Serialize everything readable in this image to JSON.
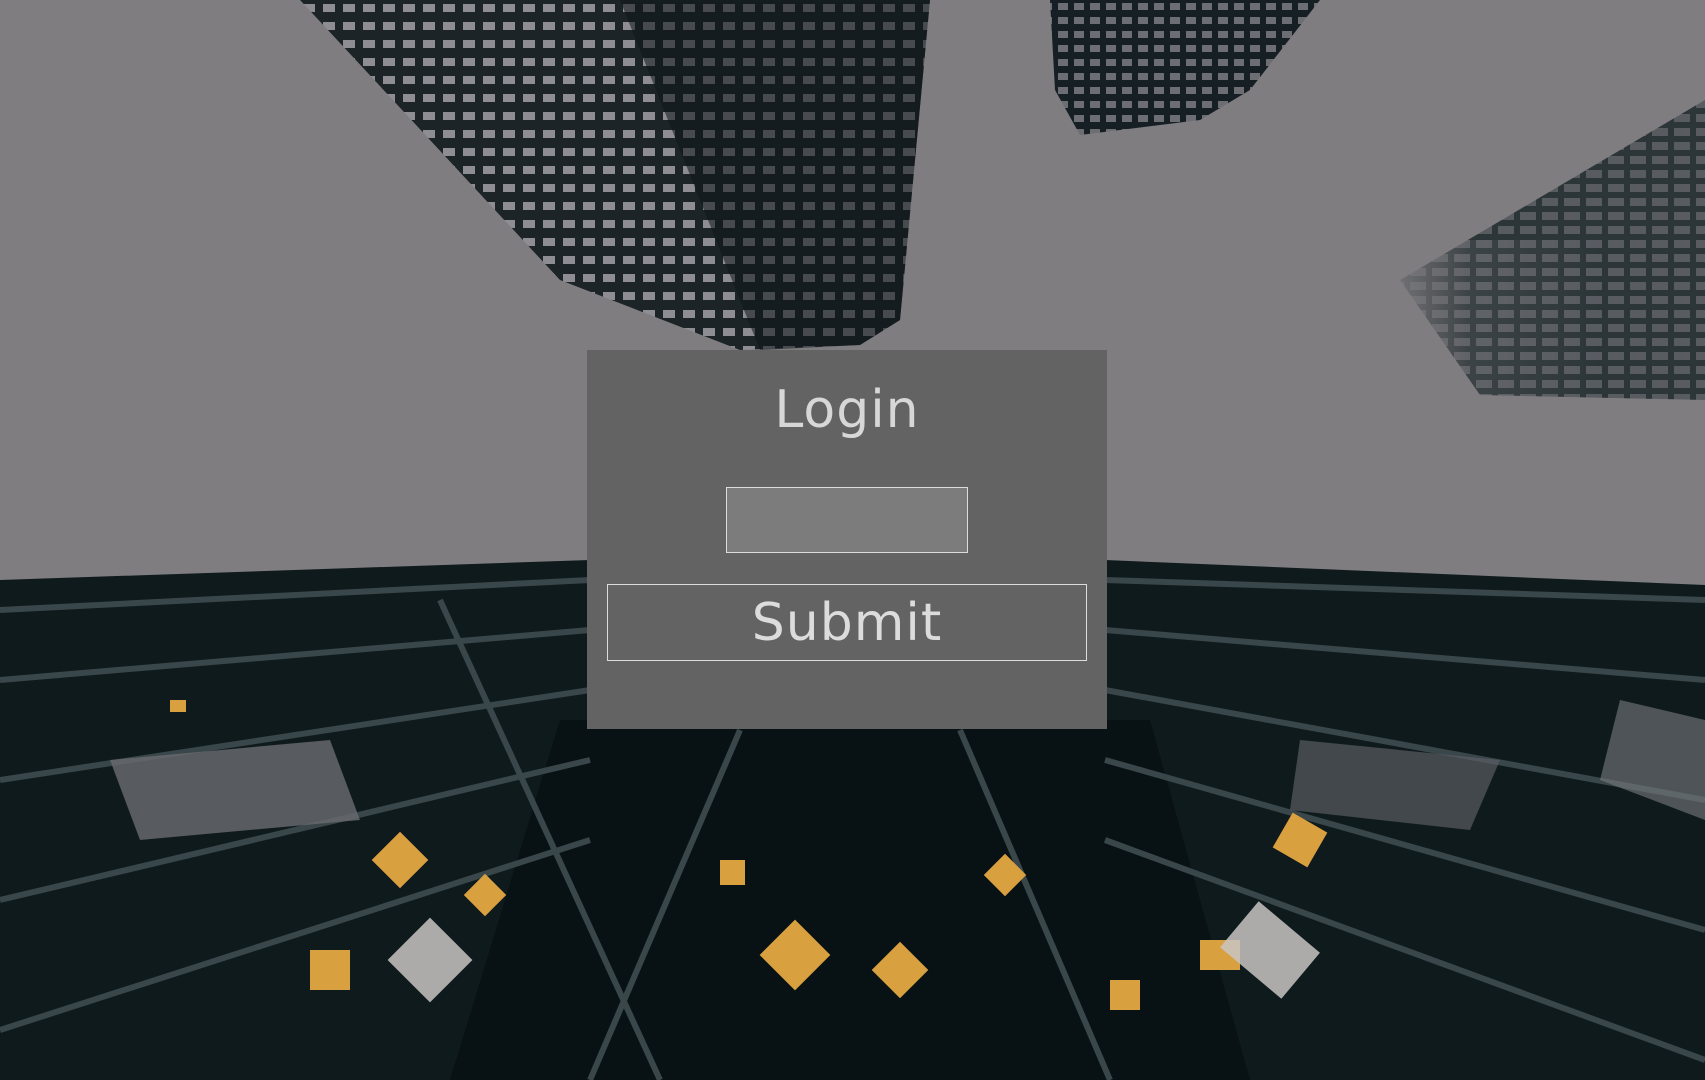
{
  "login": {
    "title": "Login",
    "username_value": "",
    "submit_label": "Submit"
  },
  "colors": {
    "panel_bg": "#636363",
    "text": "#d7d7d7",
    "input_bg": "#7c7c7c",
    "border": "#dcdcdc",
    "sky": "#7f7d80",
    "building_dark": "#0f1a1d",
    "window_light": "#d9a040"
  }
}
